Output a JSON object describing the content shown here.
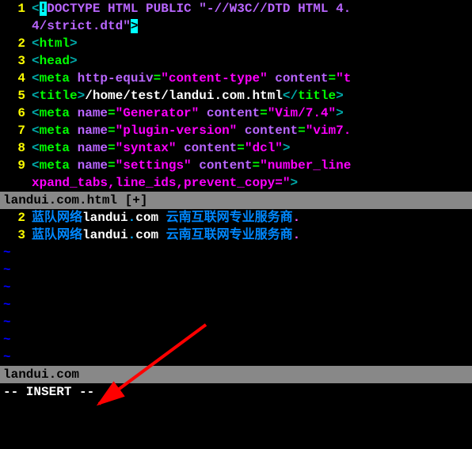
{
  "pane1": {
    "lines": [
      {
        "num": "1",
        "tokens": [
          {
            "cls": "angle",
            "t": "<"
          },
          {
            "cls": "cursor-block",
            "t": "!"
          },
          {
            "cls": "doctype",
            "t": "DOCTYPE HTML PUBLIC \"-//W3C//DTD HTML 4."
          }
        ]
      },
      {
        "num": "",
        "tokens": [
          {
            "cls": "doctype",
            "t": "4/strict.dtd\""
          },
          {
            "cls": "cursor-block",
            "t": ">"
          }
        ]
      },
      {
        "num": "2",
        "tokens": [
          {
            "cls": "angle",
            "t": "<"
          },
          {
            "cls": "tag",
            "t": "html"
          },
          {
            "cls": "angle",
            "t": ">"
          }
        ]
      },
      {
        "num": "3",
        "tokens": [
          {
            "cls": "angle",
            "t": "<"
          },
          {
            "cls": "tag",
            "t": "head"
          },
          {
            "cls": "angle",
            "t": ">"
          }
        ]
      },
      {
        "num": "4",
        "tokens": [
          {
            "cls": "angle",
            "t": "<"
          },
          {
            "cls": "tag",
            "t": "meta"
          },
          {
            "cls": "",
            "t": " "
          },
          {
            "cls": "attrname",
            "t": "http-equiv"
          },
          {
            "cls": "tag",
            "t": "="
          },
          {
            "cls": "attrval",
            "t": "\"content-type\""
          },
          {
            "cls": "",
            "t": " "
          },
          {
            "cls": "attrname",
            "t": "content"
          },
          {
            "cls": "tag",
            "t": "="
          },
          {
            "cls": "attrval",
            "t": "\"t"
          }
        ]
      },
      {
        "num": "5",
        "tokens": [
          {
            "cls": "angle",
            "t": "<"
          },
          {
            "cls": "tag",
            "t": "title"
          },
          {
            "cls": "angle",
            "t": ">"
          },
          {
            "cls": "titlepath",
            "t": "/home/test/landui.com.html"
          },
          {
            "cls": "angle",
            "t": "</"
          },
          {
            "cls": "tag",
            "t": "title"
          },
          {
            "cls": "angle",
            "t": ">"
          }
        ]
      },
      {
        "num": "6",
        "tokens": [
          {
            "cls": "angle",
            "t": "<"
          },
          {
            "cls": "tag",
            "t": "meta"
          },
          {
            "cls": "",
            "t": " "
          },
          {
            "cls": "attrname",
            "t": "name"
          },
          {
            "cls": "tag",
            "t": "="
          },
          {
            "cls": "attrval",
            "t": "\"Generator\""
          },
          {
            "cls": "",
            "t": " "
          },
          {
            "cls": "attrname",
            "t": "content"
          },
          {
            "cls": "tag",
            "t": "="
          },
          {
            "cls": "attrval",
            "t": "\"Vim/7.4\""
          },
          {
            "cls": "angle",
            "t": ">"
          }
        ]
      },
      {
        "num": "7",
        "tokens": [
          {
            "cls": "angle",
            "t": "<"
          },
          {
            "cls": "tag",
            "t": "meta"
          },
          {
            "cls": "",
            "t": " "
          },
          {
            "cls": "attrname",
            "t": "name"
          },
          {
            "cls": "tag",
            "t": "="
          },
          {
            "cls": "attrval",
            "t": "\"plugin-version\""
          },
          {
            "cls": "",
            "t": " "
          },
          {
            "cls": "attrname",
            "t": "content"
          },
          {
            "cls": "tag",
            "t": "="
          },
          {
            "cls": "attrval",
            "t": "\"vim7."
          }
        ]
      },
      {
        "num": "8",
        "tokens": [
          {
            "cls": "angle",
            "t": "<"
          },
          {
            "cls": "tag",
            "t": "meta"
          },
          {
            "cls": "",
            "t": " "
          },
          {
            "cls": "attrname",
            "t": "name"
          },
          {
            "cls": "tag",
            "t": "="
          },
          {
            "cls": "attrval",
            "t": "\"syntax\""
          },
          {
            "cls": "",
            "t": " "
          },
          {
            "cls": "attrname",
            "t": "content"
          },
          {
            "cls": "tag",
            "t": "="
          },
          {
            "cls": "attrval",
            "t": "\"dcl\""
          },
          {
            "cls": "angle",
            "t": ">"
          }
        ]
      },
      {
        "num": "9",
        "tokens": [
          {
            "cls": "angle",
            "t": "<"
          },
          {
            "cls": "tag",
            "t": "meta"
          },
          {
            "cls": "",
            "t": " "
          },
          {
            "cls": "attrname",
            "t": "name"
          },
          {
            "cls": "tag",
            "t": "="
          },
          {
            "cls": "attrval",
            "t": "\"settings\""
          },
          {
            "cls": "",
            "t": " "
          },
          {
            "cls": "attrname",
            "t": "content"
          },
          {
            "cls": "tag",
            "t": "="
          },
          {
            "cls": "attrval",
            "t": "\"number_line"
          }
        ]
      },
      {
        "num": "",
        "tokens": [
          {
            "cls": "attrval",
            "t": "xpand_tabs,line_ids,prevent_copy=\""
          },
          {
            "cls": "angle",
            "t": ">"
          }
        ]
      }
    ],
    "status": "landui.com.html [+]"
  },
  "pane2": {
    "lines": [
      {
        "num": "2",
        "tokens": [
          {
            "cls": "cn",
            "t": "蓝队网络"
          },
          {
            "cls": "cn2",
            "t": "landui"
          },
          {
            "cls": "cndot",
            "t": "."
          },
          {
            "cls": "cn2",
            "t": "com"
          },
          {
            "cls": "cn",
            "t": " 云南互联网专业服务商"
          },
          {
            "cls": "period",
            "t": "."
          }
        ]
      },
      {
        "num": "3",
        "tokens": [
          {
            "cls": "cn",
            "t": "蓝队网络"
          },
          {
            "cls": "cn2",
            "t": "landui"
          },
          {
            "cls": "cndot",
            "t": "."
          },
          {
            "cls": "cn2",
            "t": "com"
          },
          {
            "cls": "cn",
            "t": " 云南互联网专业服务商"
          },
          {
            "cls": "period",
            "t": "."
          }
        ]
      }
    ],
    "tildes": [
      "~",
      "~",
      "~",
      "~",
      "~",
      "~",
      "~"
    ],
    "status": "landui.com"
  },
  "mode": "-- INSERT --"
}
